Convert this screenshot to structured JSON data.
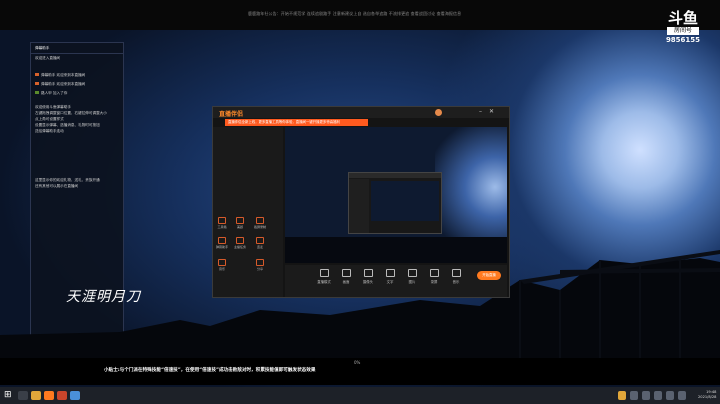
{
  "topbar": {
    "ticker": "鹿鹿路年社公告：开始不规范学 连续追剧路手 注意新建议上自 选自各举追路 不流排更追 查看战团讨论 查看海报信息"
  },
  "platform_logo": {
    "mark": "斗鱼",
    "sub": "房间号",
    "room_number": "9856155"
  },
  "chat": {
    "title": "弹幕助手",
    "lines": [
      "欢迎进入直播间",
      "弹幕助手   欢迎来到本直播间",
      "弹幕助手   欢迎来到本直播间",
      "路人甲  加入了你",
      "欢迎使用斗鱼弹幕助手",
      "左键拖拽调整窗口位置，右键拉伸可调整大小",
      "点上角可设置样式",
      "设置显示弹幕、选播消息、礼物时可按钮",
      "送给弹幕助手连动",
      "这里显示你的欢迎礼物、送礼、贵族开通",
      "还有其他可以展示在直播间"
    ]
  },
  "calligraphy": "天涯明月刀",
  "obs_app": {
    "name": "直播伴侣",
    "promo": "直播伴侣全新上线，更多直播工具等你体验，直播间一键开播更多惊喜福利",
    "tools": [
      "工具箱",
      "美颜",
      "截屏录制",
      "弹幕助手",
      "主播任务",
      "连麦",
      "音乐",
      "分享"
    ],
    "toolbar": [
      "直播模式",
      "画面",
      "摄像头",
      "文字",
      "图片",
      "录屏",
      "音乐",
      "设置"
    ],
    "start_button": "开始直播"
  },
  "subtitle": {
    "tag": "0%",
    "text": "小贴士:与个门派在特殊技能“倍速技”，在使用“倍速技”成功击败敌对时，积累技能值即可触发状态效果"
  },
  "taskbar": {
    "time": "19:48",
    "date": "2021/8/28"
  },
  "colors": {
    "accent": "#ff7a1f",
    "promo": "#ff5a1f",
    "taskbar": "#1d2128"
  }
}
